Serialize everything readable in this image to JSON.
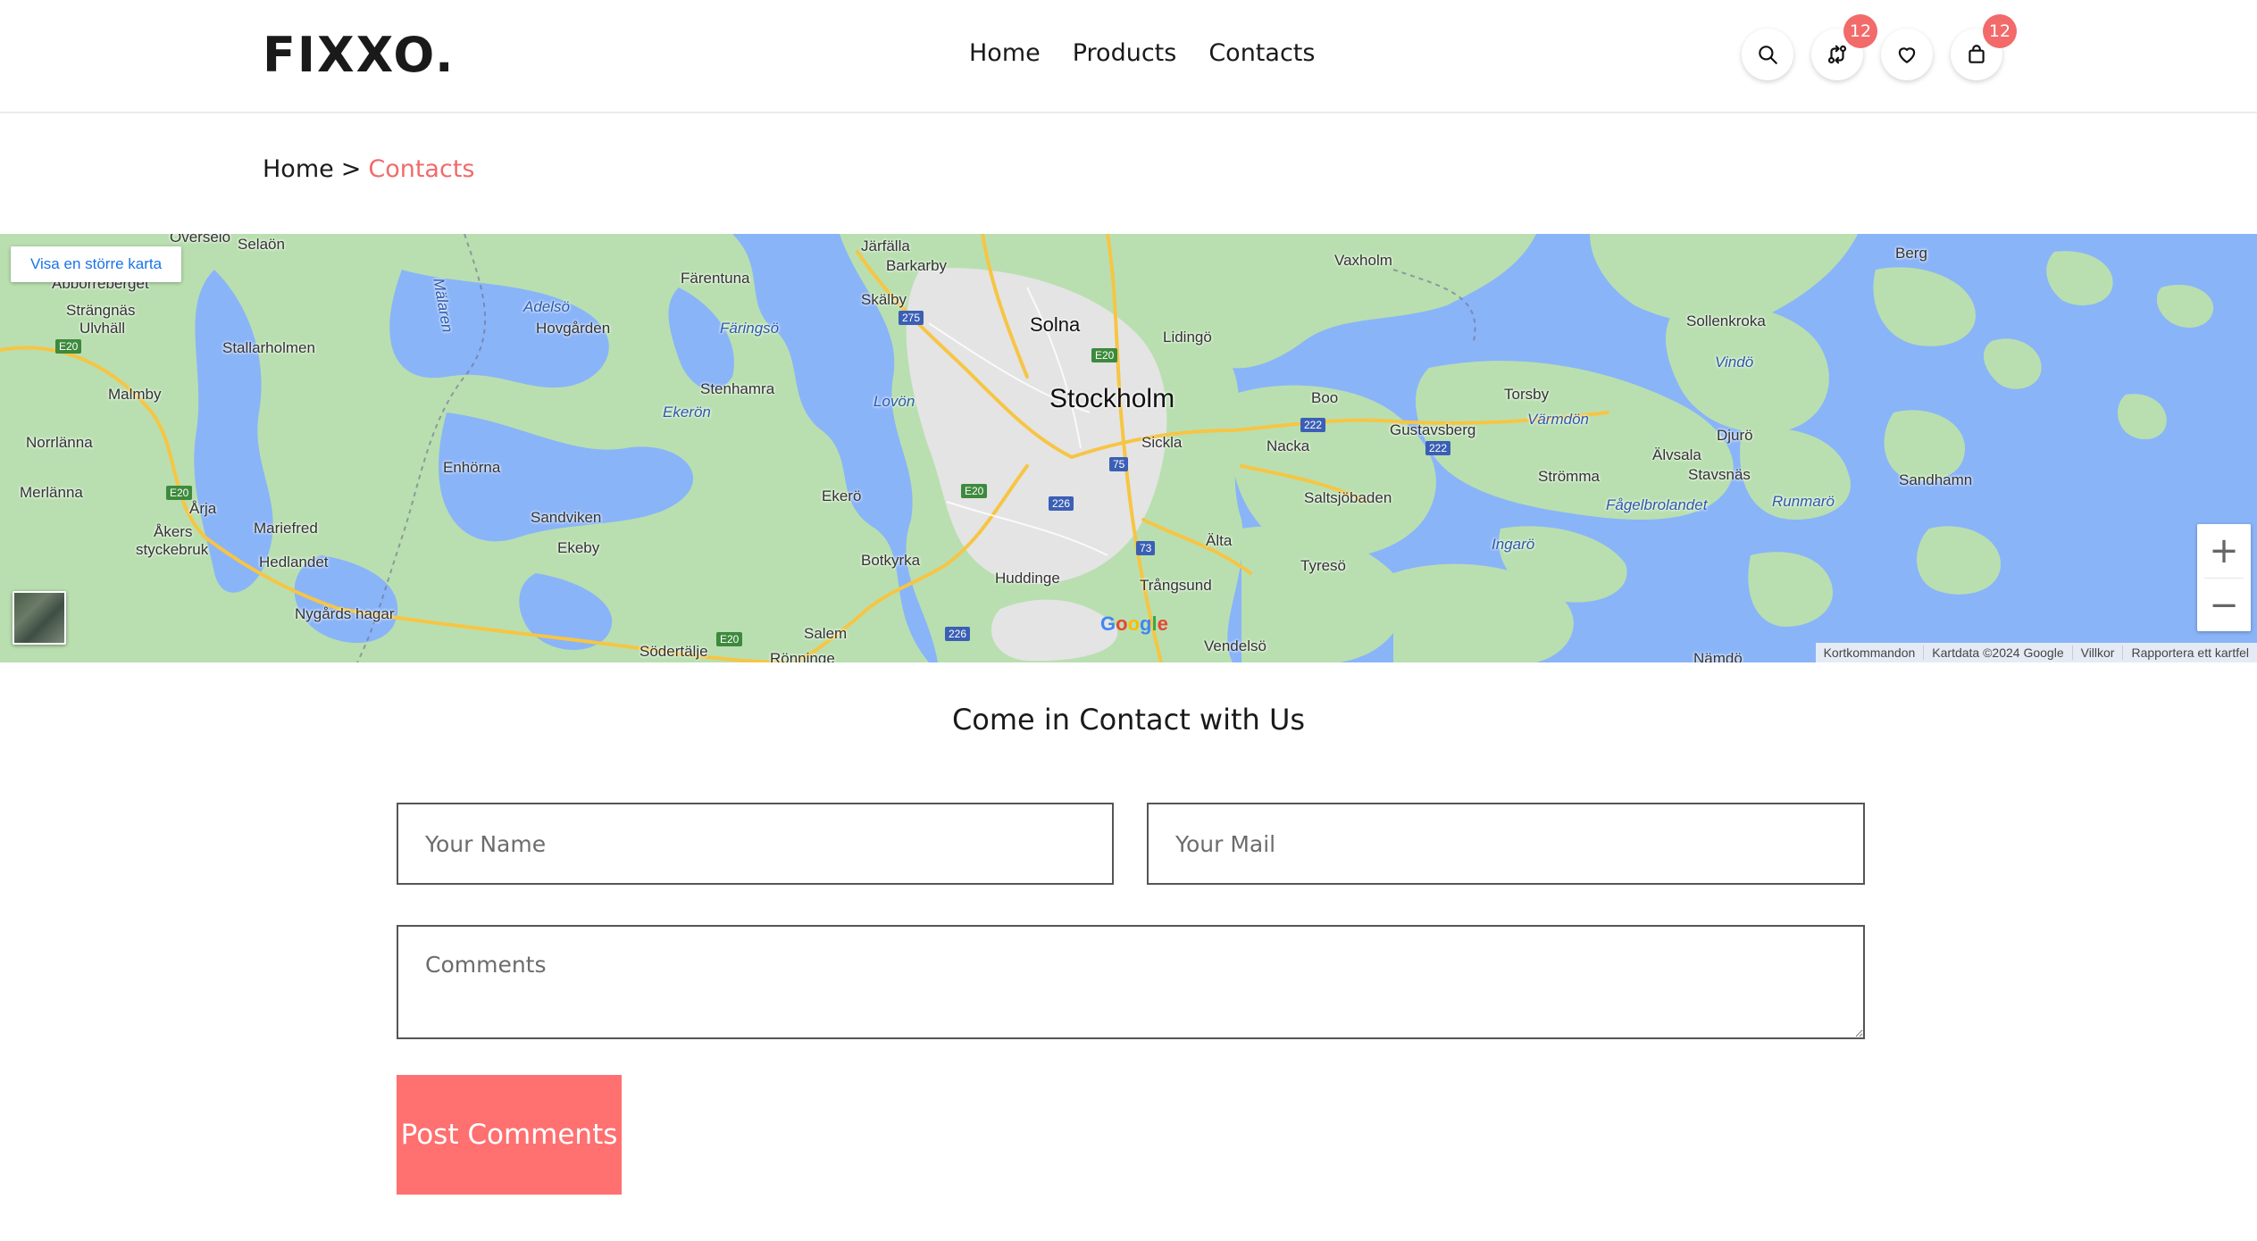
{
  "brand": {
    "logo": "FIXXO."
  },
  "nav": {
    "items": [
      "Home",
      "Products",
      "Contacts"
    ]
  },
  "header_icons": {
    "search": {
      "icon": "search-icon"
    },
    "compare": {
      "icon": "compare-arrows-icon",
      "badge": "12"
    },
    "wishlist": {
      "icon": "heart-icon"
    },
    "cart": {
      "icon": "shopping-bag-icon",
      "badge": "12"
    }
  },
  "breadcrumb": {
    "home": "Home",
    "separator": ">",
    "current": "Contacts"
  },
  "map": {
    "bigger_map_link": "Visa en större karta",
    "zoom_in": "+",
    "zoom_out": "−",
    "google_logo": "Google",
    "attribution": {
      "shortcuts": "Kortkommandon",
      "map_data": "Kartdata ©2024 Google",
      "terms": "Villkor",
      "report": "Rapportera ett kartfel"
    },
    "labels": {
      "stockholm": "Stockholm",
      "solna": "Solna",
      "jarfalla": "Järfälla",
      "barkarby": "Barkarby",
      "skalby": "Skälby",
      "farentuna": "Färentuna",
      "selaon": "Selaön",
      "overselo": "Överselö",
      "abborreberget": "Abborreberget",
      "strangnas": "Strängnäs",
      "ulvhall": "Ulvhäll",
      "stallarholmen": "Stallarholmen",
      "malmby": "Malmby",
      "norrlanna": "Norrlänna",
      "merlanna": "Merlänna",
      "arja": "Årja",
      "akers_styckebruk_1": "Åkers",
      "akers_styckebruk_2": "styckebruk",
      "mariefred": "Mariefred",
      "hedlandet": "Hedlandet",
      "nygards_hagar": "Nygårds hagar",
      "adelso": "Adelsö",
      "hovgarden": "Hovgården",
      "faringso": "Färingsö",
      "malaren": "Mälaren",
      "stenhamra": "Stenhamra",
      "ekeron": "Ekerön",
      "lovon": "Lovön",
      "enhorna": "Enhörna",
      "sandviken": "Sandviken",
      "ekeby": "Ekeby",
      "ekero": "Ekerö",
      "botkyrka": "Botkyrka",
      "huddinge": "Huddinge",
      "salem": "Salem",
      "sodertalje": "Södertälje",
      "ronninge": "Rönninge",
      "lidingo": "Lidingö",
      "sickla": "Sickla",
      "nacka": "Nacka",
      "boo": "Boo",
      "alta": "Älta",
      "tyreso": "Tyresö",
      "trangsund": "Trångsund",
      "vendelso": "Vendelsö",
      "saltsjobaden": "Saltsjöbaden",
      "vaxholm": "Vaxholm",
      "gustavsberg": "Gustavsberg",
      "torsby": "Torsby",
      "varmdon": "Värmdön",
      "stromma": "Strömma",
      "fagelbrolandet": "Fågelbrolandet",
      "ingaro": "Ingarö",
      "berg": "Berg",
      "sollenkroka": "Sollenkroka",
      "vindo": "Vindö",
      "djuro": "Djurö",
      "alvsala": "Älvsala",
      "stavsnas": "Stavsnäs",
      "runmaro": "Runmarö",
      "sandhamn": "Sandhamn",
      "namdo": "Nämdö"
    },
    "road_shields": {
      "e20_a": "E20",
      "e20_b": "E20",
      "e20_c": "E20",
      "e20_d": "E20",
      "e20_e": "E20",
      "r275": "275",
      "r222_a": "222",
      "r222_b": "222",
      "r75": "75",
      "r226_a": "226",
      "r226_b": "226",
      "r73": "73"
    },
    "colors": {
      "water": "#8ab4f8",
      "land": "#b9dfb0",
      "urban": "#e8e8e8",
      "road": "#f6c544"
    }
  },
  "contact": {
    "title": "Come in Contact with Us",
    "name_placeholder": "Your Name",
    "mail_placeholder": "Your Mail",
    "comments_placeholder": "Comments",
    "submit_label": "Post Comments"
  },
  "colors": {
    "accent": "#f26a6a",
    "button": "#ff7070"
  }
}
